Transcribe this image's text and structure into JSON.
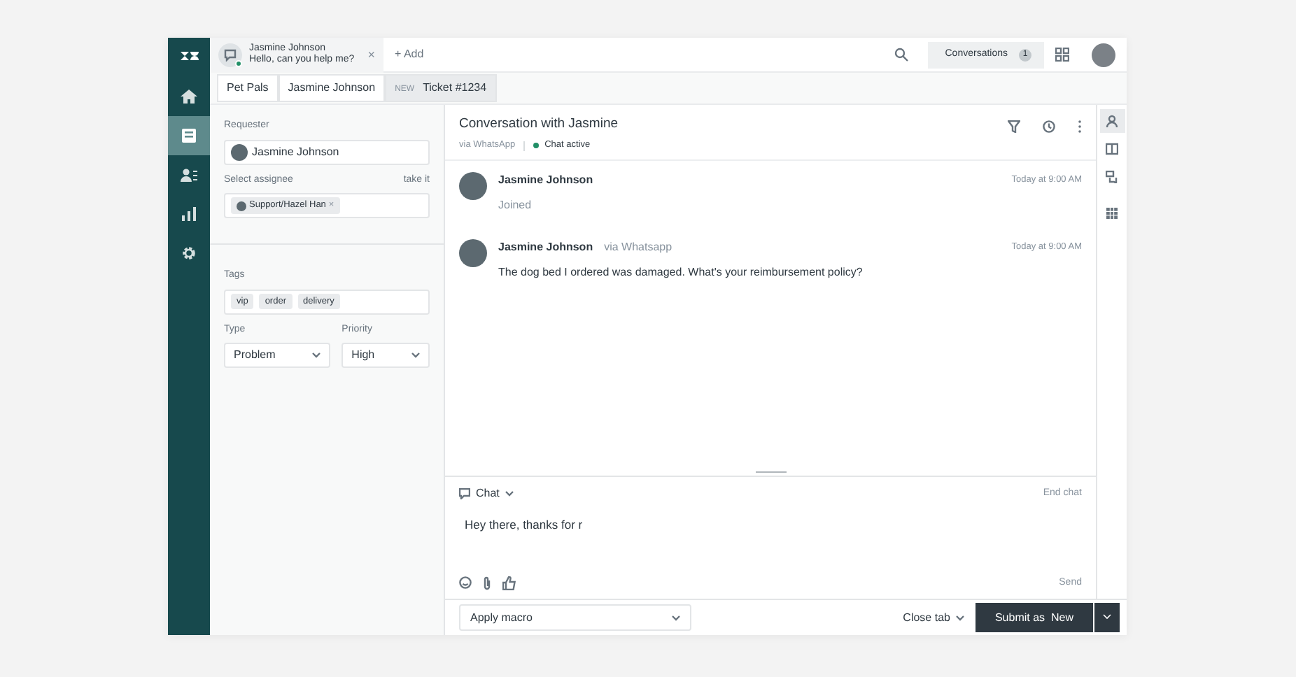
{
  "nav_items": [
    {
      "kind": "logo",
      "selected": false
    },
    {
      "kind": "home",
      "selected": false
    },
    {
      "kind": "tickets",
      "selected": true
    },
    {
      "kind": "contacts",
      "selected": false
    },
    {
      "kind": "reports",
      "selected": false
    },
    {
      "kind": "settings",
      "selected": false
    }
  ],
  "top_tab": {
    "name": "Jasmine Johnson",
    "preview": "Hello, can you help me?",
    "close": "×",
    "online": true
  },
  "add_tab": "+ Add",
  "conversations": {
    "label": "Conversations",
    "count": "1"
  },
  "breadcrumbs": [
    {
      "label": "Pet Pals",
      "selected": false
    },
    {
      "label": "Jasmine Johnson",
      "selected": false
    },
    {
      "badge": "NEW",
      "label": "Ticket #1234",
      "selected": true
    }
  ],
  "ticket": {
    "requester_label": "Requester",
    "requester": "Jasmine Johnson",
    "assignee_label": "Select assignee",
    "take_it": "take it",
    "assignee": "Support/Hazel Han",
    "assignee_remove": "×",
    "tags_label": "Tags",
    "tags": [
      "vip",
      "order",
      "delivery"
    ],
    "type_label": "Type",
    "type": "Problem",
    "priority_label": "Priority",
    "priority": "High"
  },
  "conversation": {
    "title": "Conversation with Jasmine",
    "channel": "via WhatsApp",
    "status": "Chat active",
    "messages": [
      {
        "kind": "event",
        "author": "Jasmine Johnson",
        "time": "Today at 9:00 AM",
        "text": "Joined"
      },
      {
        "kind": "message",
        "author": "Jasmine Johnson",
        "via": "via Whatsapp",
        "time": "Today at 9:00 AM",
        "text": "The dog bed I ordered was damaged. What's your reimbursement policy?"
      }
    ]
  },
  "composer": {
    "channel": "Chat",
    "end_chat": "End chat",
    "draft": "Hey there, thanks for r",
    "send": "Send"
  },
  "side_rail": [
    {
      "kind": "user",
      "selected": true
    },
    {
      "kind": "book",
      "selected": false
    },
    {
      "kind": "chat",
      "selected": false
    },
    {
      "kind": "apps",
      "selected": false
    }
  ],
  "footer": {
    "macro": "Apply macro",
    "close_tab": "Close tab",
    "submit": "Submit as  New"
  }
}
